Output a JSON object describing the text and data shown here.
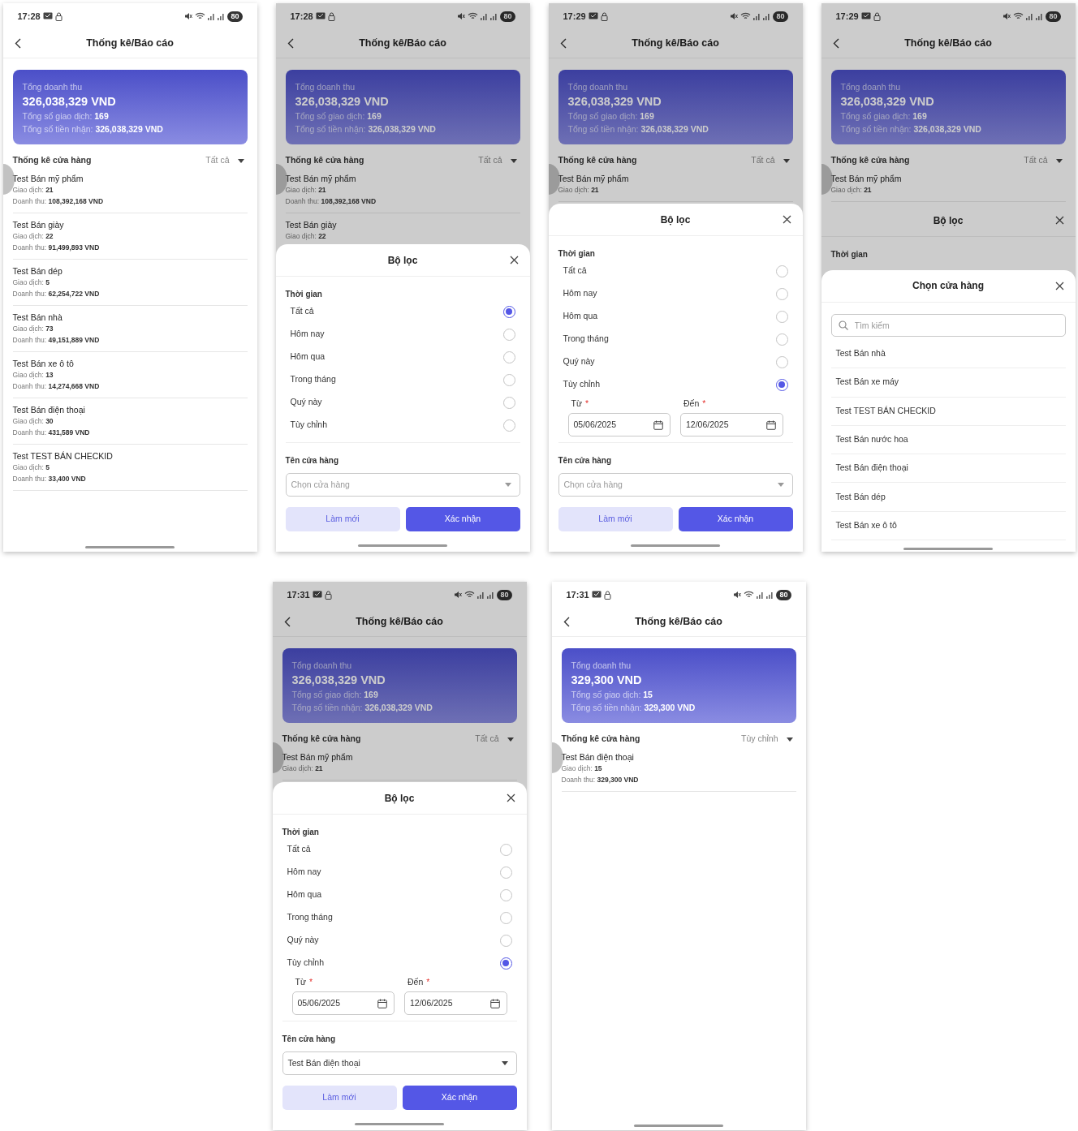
{
  "phones": [
    {
      "status_bar": {
        "time": "17:28",
        "battery": "80"
      },
      "header": {
        "title": "Thống kê/Báo cáo"
      },
      "summary": {
        "label": "Tổng doanh thu",
        "amount": "326,038,329 VND",
        "transactions": "Tổng số giao dịch: **169**",
        "received": "Tổng số tiền nhận: **326,038,329 VND**"
      },
      "section": {
        "title": "Thống kê cửa hàng",
        "filter": "Tất cả"
      },
      "stores": [
        {
          "name": "Test Bán mỹ phẩm",
          "transactions": "Giao dịch: **21**",
          "revenue": "Doanh thu: **108,392,168 VND**"
        },
        {
          "name": "Test Bán giày",
          "transactions": "Giao dịch: **22**",
          "revenue": "Doanh thu: **91,499,893 VND**"
        },
        {
          "name": "Test Bán dép",
          "transactions": "Giao dịch: **5**",
          "revenue": "Doanh thu: **62,254,722 VND**"
        },
        {
          "name": "Test Bán nhà",
          "transactions": "Giao dịch: **73**",
          "revenue": "Doanh thu: **49,151,889 VND**"
        },
        {
          "name": "Test Bán xe ô tô",
          "transactions": "Giao dịch: **13**",
          "revenue": "Doanh thu: **14,274,668 VND**"
        },
        {
          "name": "Test Bán điện thoại",
          "transactions": "Giao dịch: **30**",
          "revenue": "Doanh thu: **431,589 VND**"
        },
        {
          "name": "Test TEST BÁN CHECKID",
          "transactions": "Giao dịch: **5**",
          "revenue": "Doanh thu: **33,400 VND**"
        }
      ]
    },
    {
      "status_bar": {
        "time": "17:28",
        "battery": "80"
      },
      "header": {
        "title": "Thống kê/Báo cáo"
      },
      "summary": {
        "label": "Tổng doanh thu",
        "amount": "326,038,329 VND",
        "transactions": "Tổng số giao dịch: **169**",
        "received": "Tổng số tiền nhận: **326,038,329 VND**"
      },
      "section": {
        "title": "Thống kê cửa hàng",
        "filter": "Tất cả"
      },
      "stores": [
        {
          "name": "Test Bán mỹ phẩm",
          "transactions": "Giao dịch: **21**",
          "revenue": "Doanh thu: **108,392,168 VND**"
        },
        {
          "name": "Test Bán giày",
          "transactions": "Giao dịch: **22**"
        }
      ],
      "sheets": [
        {
          "kind": "filter",
          "title": "Bộ lọc",
          "time_label": "Thời gian",
          "options": [
            {
              "label": "Tất cả",
              "selected": true
            },
            {
              "label": "Hôm nay",
              "selected": false
            },
            {
              "label": "Hôm qua",
              "selected": false
            },
            {
              "label": "Trong tháng",
              "selected": false
            },
            {
              "label": "Quý này",
              "selected": false
            },
            {
              "label": "Tùy chỉnh",
              "selected": false
            }
          ],
          "store_label": "Tên cửa hàng",
          "store_select": {
            "placeholder": "Chọn cửa hàng"
          },
          "buttons": [
            {
              "label": "Làm mới",
              "kind": "secondary"
            },
            {
              "label": "Xác nhận",
              "kind": "primary"
            }
          ]
        }
      ]
    },
    {
      "status_bar": {
        "time": "17:29",
        "battery": "80"
      },
      "header": {
        "title": "Thống kê/Báo cáo"
      },
      "summary": {
        "label": "Tổng doanh thu",
        "amount": "326,038,329 VND",
        "transactions": "Tổng số giao dịch: **169**",
        "received": "Tổng số tiền nhận: **326,038,329 VND**"
      },
      "section": {
        "title": "Thống kê cửa hàng",
        "filter": "Tất cả"
      },
      "stores": [
        {
          "name": "Test Bán mỹ phẩm",
          "transactions": "Giao dịch: **21**"
        }
      ],
      "sheets": [
        {
          "kind": "filter",
          "title": "Bộ lọc",
          "time_label": "Thời gian",
          "options": [
            {
              "label": "Tất cả",
              "selected": false
            },
            {
              "label": "Hôm nay",
              "selected": false
            },
            {
              "label": "Hôm qua",
              "selected": false
            },
            {
              "label": "Trong tháng",
              "selected": false
            },
            {
              "label": "Quý này",
              "selected": false
            },
            {
              "label": "Tùy chỉnh",
              "selected": true
            }
          ],
          "date_range": [
            {
              "label": "Từ",
              "required_mark": "*",
              "value": "05/06/2025"
            },
            {
              "label": "Đến",
              "required_mark": "*",
              "value": "12/06/2025"
            }
          ],
          "store_label": "Tên cửa hàng",
          "store_select": {
            "placeholder": "Chọn cửa hàng"
          },
          "buttons": [
            {
              "label": "Làm mới",
              "kind": "secondary"
            },
            {
              "label": "Xác nhận",
              "kind": "primary"
            }
          ]
        }
      ]
    },
    {
      "status_bar": {
        "time": "17:29",
        "battery": "80"
      },
      "header": {
        "title": "Thống kê/Báo cáo"
      },
      "summary": {
        "label": "Tổng doanh thu",
        "amount": "326,038,329 VND",
        "transactions": "Tổng số giao dịch: **169**",
        "received": "Tổng số tiền nhận: **326,038,329 VND**"
      },
      "section": {
        "title": "Thống kê cửa hàng",
        "filter": "Tất cả"
      },
      "stores": [
        {
          "name": "Test Bán mỹ phẩm",
          "transactions": "Giao dịch: **21**"
        }
      ],
      "sheets": [
        {
          "kind": "filter",
          "title": "Bộ lọc",
          "time_label": "Thời gian"
        },
        {
          "kind": "store_picker",
          "title": "Chọn cửa hàng",
          "search": {
            "placeholder": "Tìm kiếm"
          },
          "items": [
            "Test Bán nhà",
            "Test Bán xe máy",
            "Test TEST BÁN CHECKID",
            "Test Bán nước hoa",
            "Test Bán điện thoại",
            "Test Bán dép",
            "Test Bán xe ô tô"
          ]
        }
      ]
    },
    {
      "status_bar": {
        "time": "17:31",
        "battery": "80"
      },
      "header": {
        "title": "Thống kê/Báo cáo"
      },
      "summary": {
        "label": "Tổng doanh thu",
        "amount": "326,038,329 VND",
        "transactions": "Tổng số giao dịch: **169**",
        "received": "Tổng số tiền nhận: **326,038,329 VND**"
      },
      "section": {
        "title": "Thống kê cửa hàng",
        "filter": "Tất cả"
      },
      "stores": [
        {
          "name": "Test Bán mỹ phẩm",
          "transactions": "Giao dịch: **21**"
        }
      ],
      "sheets": [
        {
          "kind": "filter",
          "title": "Bộ lọc",
          "time_label": "Thời gian",
          "options": [
            {
              "label": "Tất cả",
              "selected": false
            },
            {
              "label": "Hôm nay",
              "selected": false
            },
            {
              "label": "Hôm qua",
              "selected": false
            },
            {
              "label": "Trong tháng",
              "selected": false
            },
            {
              "label": "Quý này",
              "selected": false
            },
            {
              "label": "Tùy chỉnh",
              "selected": true
            }
          ],
          "date_range": [
            {
              "label": "Từ",
              "required_mark": "*",
              "value": "05/06/2025"
            },
            {
              "label": "Đến",
              "required_mark": "*",
              "value": "12/06/2025"
            }
          ],
          "store_label": "Tên cửa hàng",
          "store_select": {
            "value": "Test Bán điện thoại"
          },
          "buttons": [
            {
              "label": "Làm mới",
              "kind": "secondary"
            },
            {
              "label": "Xác nhận",
              "kind": "primary"
            }
          ]
        }
      ]
    },
    {
      "status_bar": {
        "time": "17:31",
        "battery": "80"
      },
      "header": {
        "title": "Thống kê/Báo cáo"
      },
      "summary": {
        "label": "Tổng doanh thu",
        "amount": "329,300 VND",
        "transactions": "Tổng số giao dịch: **15**",
        "received": "Tổng số tiền nhận: **329,300 VND**"
      },
      "section": {
        "title": "Thống kê cửa hàng",
        "filter": "Tùy chỉnh"
      },
      "stores": [
        {
          "name": "Test Bán điện thoại",
          "transactions": "Giao dịch: **15**",
          "revenue": "Doanh thu: **329,300 VND**"
        }
      ]
    }
  ]
}
